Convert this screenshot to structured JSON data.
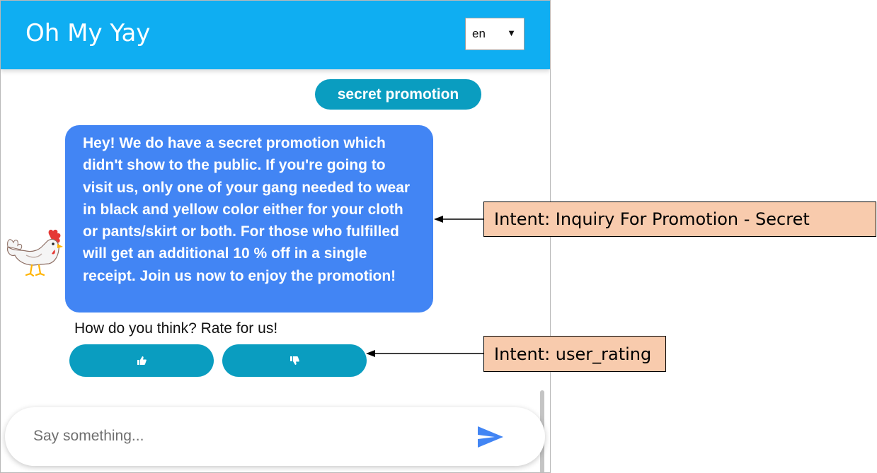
{
  "header": {
    "title": "Oh My Yay",
    "language": "en",
    "background_color": "#0faef2"
  },
  "chat": {
    "user_message": "secret promotion",
    "bot_message": "Hey! We do have a secret promotion which didn't show to the public. If you're going to visit us, only one of your gang needed to wear in black and yellow color either for your cloth or pants/skirt or both. For those who fulfilled will get an additional 10 % off in a single receipt. Join us now to enjoy the promotion!",
    "bot_avatar_icon": "rooster-icon",
    "rating_prompt": "How do you think? Rate for us!",
    "rating_buttons": [
      {
        "icon": "thumbs-up-icon"
      },
      {
        "icon": "thumbs-down-icon"
      }
    ],
    "user_bubble_color": "#0a9dc0",
    "bot_bubble_color": "#4285f4"
  },
  "input": {
    "placeholder": "Say something...",
    "send_icon": "send-icon"
  },
  "annotations": [
    {
      "label": "Intent: Inquiry For Promotion - Secret"
    },
    {
      "label": "Intent: user_rating"
    }
  ]
}
